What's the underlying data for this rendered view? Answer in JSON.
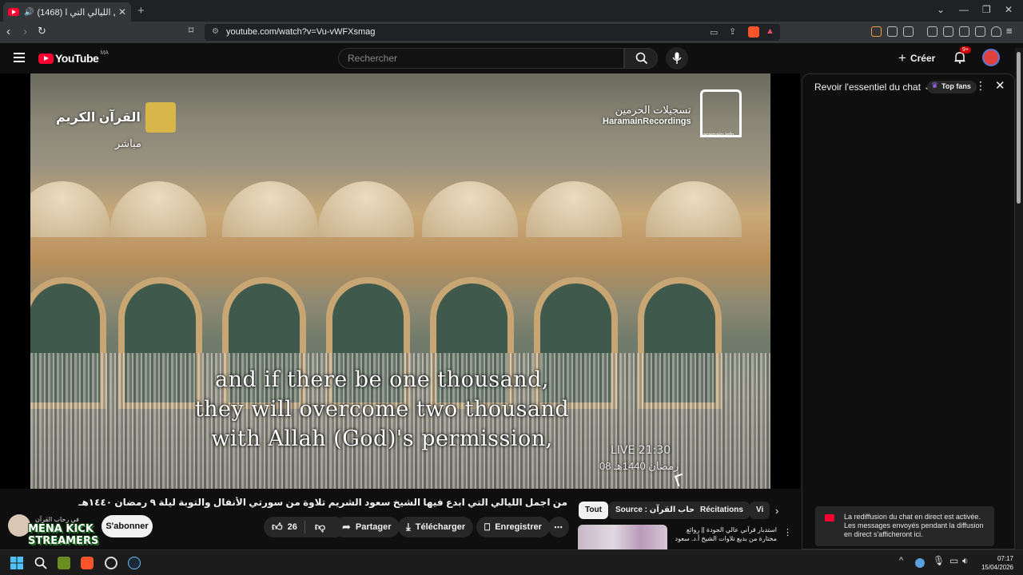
{
  "browser": {
    "tab_title": "(1468) من اجمل الليالي التي ا...",
    "url": "youtube.com/watch?v=Vu-vWFXsmag"
  },
  "header": {
    "logo_text": "YouTube",
    "country_code": "MA",
    "search_placeholder": "Rechercher",
    "create_label": "Créer",
    "notifications_badge": "9+"
  },
  "video": {
    "subtitle_lines": [
      "and if there be one thousand,",
      "they will overcome two thousand",
      "with Allah (God)'s permission,"
    ],
    "live_label": "LIVE 21:30",
    "live_date": "08 رمضان 1440هـ",
    "channel_logo_text": "القرآن الكريم",
    "channel_live_text": "مباشر",
    "watermark_ar": "تسجيلات الحرمين",
    "watermark_en": "HaramainRecordings",
    "watermark_url": "haramain.info"
  },
  "details": {
    "title": "من اجمل الليالي التي ابدع فيها الشيخ سعود الشريم تلاوة من سورتي الأنفال والتوبة ليلة ٩ رمضان ١٤٤٠هـ",
    "channel_name": "في رحاب القرآن",
    "subscribe_label": "S'abonner",
    "likes": "26",
    "share_label": "Partager",
    "download_label": "Télécharger",
    "save_label": "Enregistrer",
    "overlay_line1": "MENA KICK",
    "overlay_line2": "STREAMERS"
  },
  "chips": {
    "all": "Tout",
    "source": "Source : في رحاب القرآن",
    "recitations": "Récitations",
    "more": "Vi"
  },
  "related": {
    "title": "استدبار قرآني عالي الجودة || روائع مختارة من بديع تلاوات الشيخ أ.د. سعود الشريم من"
  },
  "chat": {
    "header_label": "Revoir l'essentiel du chat",
    "top_fans_label": "Top fans",
    "notice": "La rediffusion du chat en direct est activée. Les messages envoyés pendant la diffusion en direct s'afficheront ici."
  },
  "taskbar": {
    "time": "07:17",
    "date": "15/04/2026"
  },
  "colors": {
    "brand_red": "#ff0033",
    "page_bg": "#0f0f0f",
    "pill_bg": "#272727"
  }
}
